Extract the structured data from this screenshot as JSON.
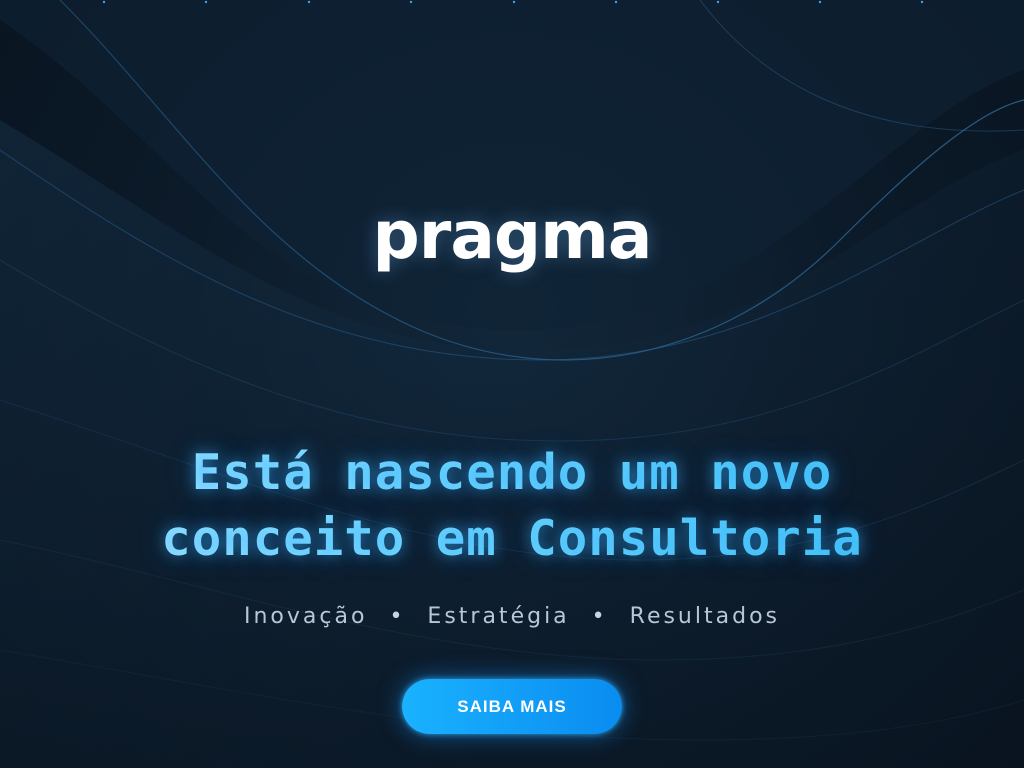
{
  "brand": {
    "logo_text": "pragma"
  },
  "hero": {
    "headline_line1": "Está nascendo um novo",
    "headline_line2": "conceito em Consultoria"
  },
  "tagline": {
    "items": [
      "Inovação",
      "Estratégia",
      "Resultados"
    ],
    "separator": "•"
  },
  "cta": {
    "label": "SAIBA MAIS"
  },
  "colors": {
    "background": "#0b1825",
    "headline_accent": "#3cc4f5",
    "cta_button": "#1aa0ff",
    "tagline_text": "#b8c6d6"
  }
}
